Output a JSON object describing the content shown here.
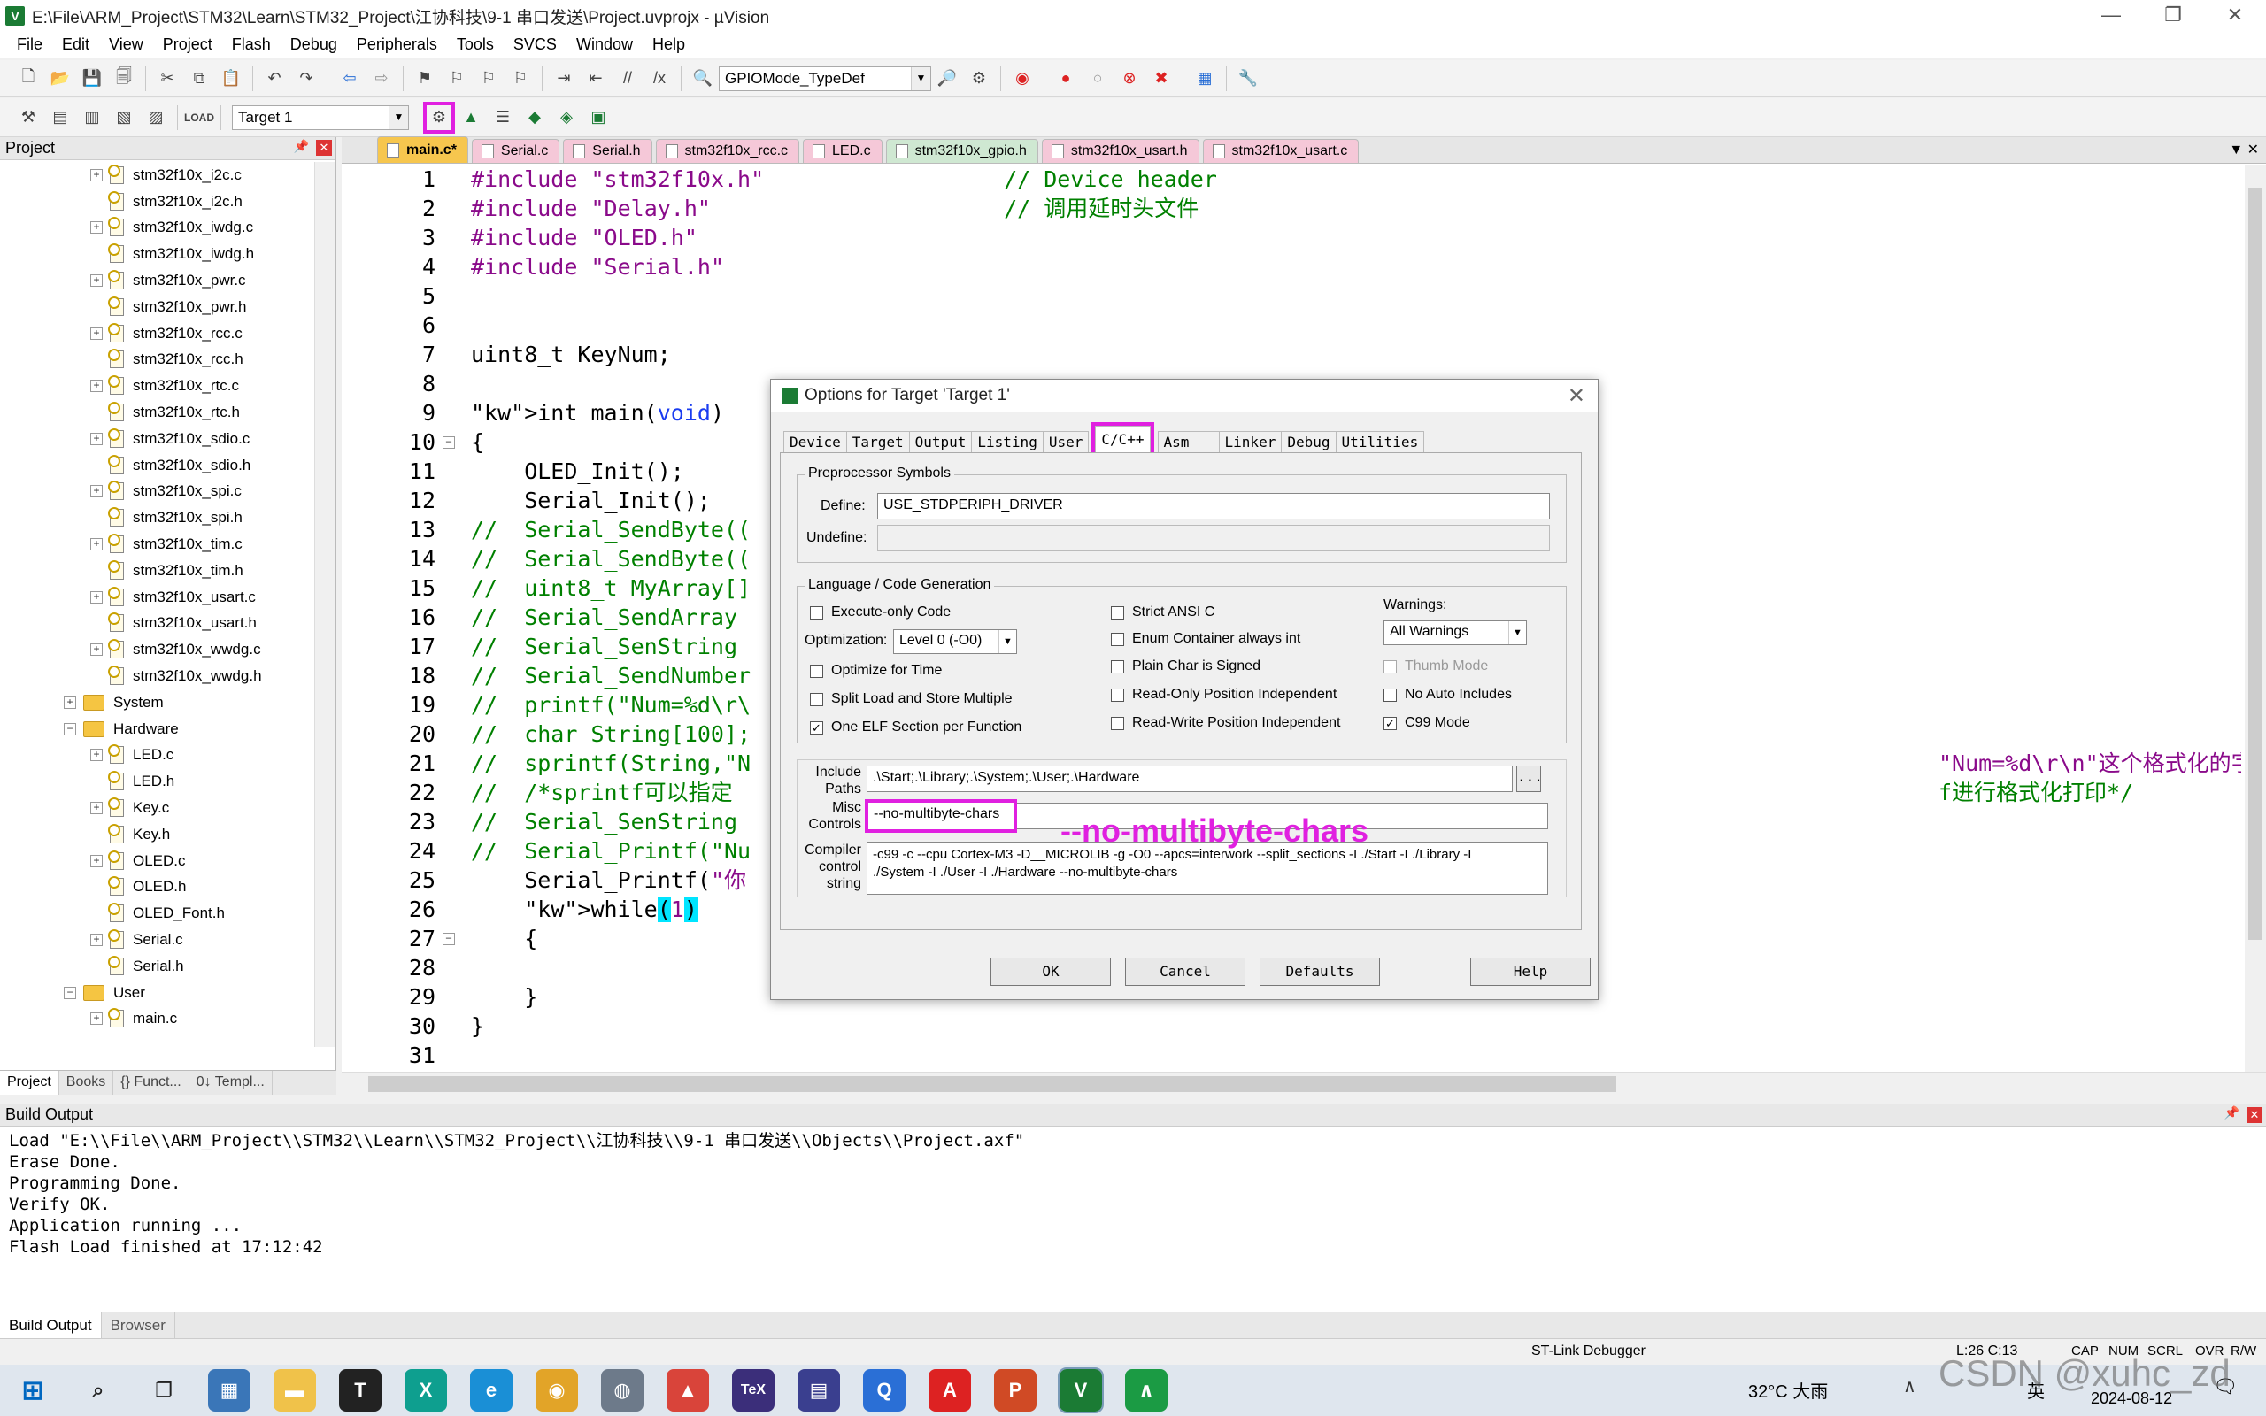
{
  "window": {
    "title": "E:\\File\\ARM_Project\\STM32\\Learn\\STM32_Project\\江协科技\\9-1 串口发送\\Project.uvprojx - µVision",
    "icon_letter": "V"
  },
  "menu": [
    "File",
    "Edit",
    "View",
    "Project",
    "Flash",
    "Debug",
    "Peripherals",
    "Tools",
    "SVCS",
    "Window",
    "Help"
  ],
  "toolbar": {
    "find_combo": "GPIOMode_TypeDef",
    "target_combo": "Target 1"
  },
  "project": {
    "header": "Project",
    "tree": [
      {
        "label": "stm32f10x_i2c.c",
        "type": "c",
        "level": 3,
        "exp": true
      },
      {
        "label": "stm32f10x_i2c.h",
        "type": "h",
        "level": 3,
        "exp": false
      },
      {
        "label": "stm32f10x_iwdg.c",
        "type": "c",
        "level": 3,
        "exp": true
      },
      {
        "label": "stm32f10x_iwdg.h",
        "type": "h",
        "level": 3,
        "exp": false
      },
      {
        "label": "stm32f10x_pwr.c",
        "type": "c",
        "level": 3,
        "exp": true
      },
      {
        "label": "stm32f10x_pwr.h",
        "type": "h",
        "level": 3,
        "exp": false
      },
      {
        "label": "stm32f10x_rcc.c",
        "type": "c",
        "level": 3,
        "exp": true
      },
      {
        "label": "stm32f10x_rcc.h",
        "type": "h",
        "level": 3,
        "exp": false
      },
      {
        "label": "stm32f10x_rtc.c",
        "type": "c",
        "level": 3,
        "exp": true
      },
      {
        "label": "stm32f10x_rtc.h",
        "type": "h",
        "level": 3,
        "exp": false
      },
      {
        "label": "stm32f10x_sdio.c",
        "type": "c",
        "level": 3,
        "exp": true
      },
      {
        "label": "stm32f10x_sdio.h",
        "type": "h",
        "level": 3,
        "exp": false
      },
      {
        "label": "stm32f10x_spi.c",
        "type": "c",
        "level": 3,
        "exp": true
      },
      {
        "label": "stm32f10x_spi.h",
        "type": "h",
        "level": 3,
        "exp": false
      },
      {
        "label": "stm32f10x_tim.c",
        "type": "c",
        "level": 3,
        "exp": true
      },
      {
        "label": "stm32f10x_tim.h",
        "type": "h",
        "level": 3,
        "exp": false
      },
      {
        "label": "stm32f10x_usart.c",
        "type": "c",
        "level": 3,
        "exp": true
      },
      {
        "label": "stm32f10x_usart.h",
        "type": "h",
        "level": 3,
        "exp": false
      },
      {
        "label": "stm32f10x_wwdg.c",
        "type": "c",
        "level": 3,
        "exp": true
      },
      {
        "label": "stm32f10x_wwdg.h",
        "type": "h",
        "level": 3,
        "exp": false
      },
      {
        "label": "System",
        "type": "folder",
        "level": 2,
        "exp": true
      },
      {
        "label": "Hardware",
        "type": "folder",
        "level": 2,
        "exp": "open"
      },
      {
        "label": "LED.c",
        "type": "c",
        "level": 3,
        "exp": true
      },
      {
        "label": "LED.h",
        "type": "h",
        "level": 3,
        "exp": false
      },
      {
        "label": "Key.c",
        "type": "c",
        "level": 3,
        "exp": true
      },
      {
        "label": "Key.h",
        "type": "h",
        "level": 3,
        "exp": false
      },
      {
        "label": "OLED.c",
        "type": "c",
        "level": 3,
        "exp": true
      },
      {
        "label": "OLED.h",
        "type": "h",
        "level": 3,
        "exp": false
      },
      {
        "label": "OLED_Font.h",
        "type": "h",
        "level": 3,
        "exp": false
      },
      {
        "label": "Serial.c",
        "type": "c",
        "level": 3,
        "exp": true
      },
      {
        "label": "Serial.h",
        "type": "h",
        "level": 3,
        "exp": false
      },
      {
        "label": "User",
        "type": "folder",
        "level": 2,
        "exp": "open"
      },
      {
        "label": "main.c",
        "type": "c",
        "level": 3,
        "exp": true
      }
    ],
    "tabs": [
      "Project",
      "Books",
      "{} Funct...",
      "0↓ Templ..."
    ]
  },
  "editor": {
    "tabs": [
      {
        "label": "main.c*",
        "color": "#f6c64e",
        "active": true
      },
      {
        "label": "Serial.c",
        "color": "#f5c8d8"
      },
      {
        "label": "Serial.h",
        "color": "#f5c8d8"
      },
      {
        "label": "stm32f10x_rcc.c",
        "color": "#f5c8d8"
      },
      {
        "label": "LED.c",
        "color": "#f5c8d8"
      },
      {
        "label": "stm32f10x_gpio.h",
        "color": "#cfe8d2"
      },
      {
        "label": "stm32f10x_usart.h",
        "color": "#f5c8d8"
      },
      {
        "label": "stm32f10x_usart.c",
        "color": "#f5c8d8"
      }
    ],
    "lines": [
      {
        "n": "1",
        "t": "#include \"stm32f10x.h\"                  // Device header"
      },
      {
        "n": "2",
        "t": "#include \"Delay.h\"                      // 调用延时头文件"
      },
      {
        "n": "3",
        "t": "#include \"OLED.h\""
      },
      {
        "n": "4",
        "t": "#include \"Serial.h\""
      },
      {
        "n": "5",
        "t": ""
      },
      {
        "n": "6",
        "t": ""
      },
      {
        "n": "7",
        "t": "uint8_t KeyNum;"
      },
      {
        "n": "8",
        "t": ""
      },
      {
        "n": "9",
        "t": "int main(void)"
      },
      {
        "n": "10",
        "t": "{",
        "fold": "-"
      },
      {
        "n": "11",
        "t": "    OLED_Init();"
      },
      {
        "n": "12",
        "t": "    Serial_Init();"
      },
      {
        "n": "13",
        "t": "//  Serial_SendByte(("
      },
      {
        "n": "14",
        "t": "//  Serial_SendByte(("
      },
      {
        "n": "15",
        "t": "//  uint8_t MyArray[]"
      },
      {
        "n": "16",
        "t": "//  Serial_SendArray"
      },
      {
        "n": "17",
        "t": "//  Serial_SenString"
      },
      {
        "n": "18",
        "t": "//  Serial_SendNumber"
      },
      {
        "n": "19",
        "t": "//  printf(\"Num=%d\\r\\"
      },
      {
        "n": "20",
        "t": "//  char String[100];"
      },
      {
        "n": "21",
        "t": "//  sprintf(String,\"N",
        "tail": "\"Num=%d\\r\\n\"这个格式化的字符串在String里"
      },
      {
        "n": "22",
        "t": "//  /*sprintf可以指定",
        "tail": "f进行格式化打印*/"
      },
      {
        "n": "23",
        "t": "//  Serial_SenString"
      },
      {
        "n": "24",
        "t": "//  Serial_Printf(\"Nu"
      },
      {
        "n": "25",
        "t": "    Serial_Printf(\"你"
      },
      {
        "n": "26",
        "t": "    while(1)"
      },
      {
        "n": "27",
        "t": "    {",
        "fold": "-"
      },
      {
        "n": "28",
        "t": ""
      },
      {
        "n": "29",
        "t": "    }"
      },
      {
        "n": "30",
        "t": "}"
      },
      {
        "n": "31",
        "t": ""
      }
    ]
  },
  "build": {
    "header": "Build Output",
    "lines": [
      "Load \"E:\\\\File\\\\ARM_Project\\\\STM32\\\\Learn\\\\STM32_Project\\\\江协科技\\\\9-1 串口发送\\\\Objects\\\\Project.axf\"",
      "Erase Done.",
      "Programming Done.",
      "Verify OK.",
      "Application running ...",
      "Flash Load finished at 17:12:42"
    ],
    "tabs": [
      "Build Output",
      "Browser"
    ]
  },
  "status": {
    "debugger": "ST-Link Debugger",
    "pos": "L:26 C:13",
    "flags": [
      "CAP",
      "NUM",
      "SCRL",
      "OVR",
      "R/W"
    ]
  },
  "taskbar": {
    "weather": "32°C 大雨",
    "date": "2024-08-12",
    "ime": "英"
  },
  "watermark": "CSDN @xuhc_zd",
  "annotation": "--no-multibyte-chars",
  "dialog": {
    "title": "Options for Target 'Target 1'",
    "tabs": [
      "Device",
      "Target",
      "Output",
      "Listing",
      "User",
      "C/C++",
      "Asm",
      "Linker",
      "Debug",
      "Utilities"
    ],
    "active_tab": "C/C++",
    "pre_group": "Preprocessor Symbols",
    "define_label": "Define:",
    "define_value": "USE_STDPERIPH_DRIVER",
    "undefine_label": "Undefine:",
    "lang_group": "Language / Code Generation",
    "opts_left": [
      {
        "label": "Execute-only Code",
        "checked": false
      },
      {
        "label": "Optimize for Time",
        "checked": false
      },
      {
        "label": "Split Load and Store Multiple",
        "checked": false
      },
      {
        "label": "One ELF Section per Function",
        "checked": true
      }
    ],
    "optimization_label": "Optimization:",
    "optimization_value": "Level 0 (-O0)",
    "opts_mid": [
      {
        "label": "Strict ANSI C",
        "checked": false
      },
      {
        "label": "Enum Container always int",
        "checked": false
      },
      {
        "label": "Plain Char is Signed",
        "checked": false
      },
      {
        "label": "Read-Only Position Independent",
        "checked": false
      },
      {
        "label": "Read-Write Position Independent",
        "checked": false
      }
    ],
    "warnings_label": "Warnings:",
    "warnings_value": "All Warnings",
    "opts_right": [
      {
        "label": "Thumb Mode",
        "checked": false,
        "disabled": true
      },
      {
        "label": "No Auto Includes",
        "checked": false
      },
      {
        "label": "C99 Mode",
        "checked": true
      }
    ],
    "include_label": "Include Paths",
    "include_value": ".\\Start;.\\Library;.\\System;.\\User;.\\Hardware",
    "misc_label": "Misc Controls",
    "misc_value": "--no-multibyte-chars",
    "compiler_label": "Compiler control string",
    "compiler_line1": "-c99 -c --cpu Cortex-M3 -D__MICROLIB -g -O0 --apcs=interwork --split_sections -I ./Start -I ./Library -I",
    "compiler_line2": "./System -I ./User -I ./Hardware --no-multibyte-chars",
    "buttons": [
      "OK",
      "Cancel",
      "Defaults",
      "Help"
    ]
  }
}
